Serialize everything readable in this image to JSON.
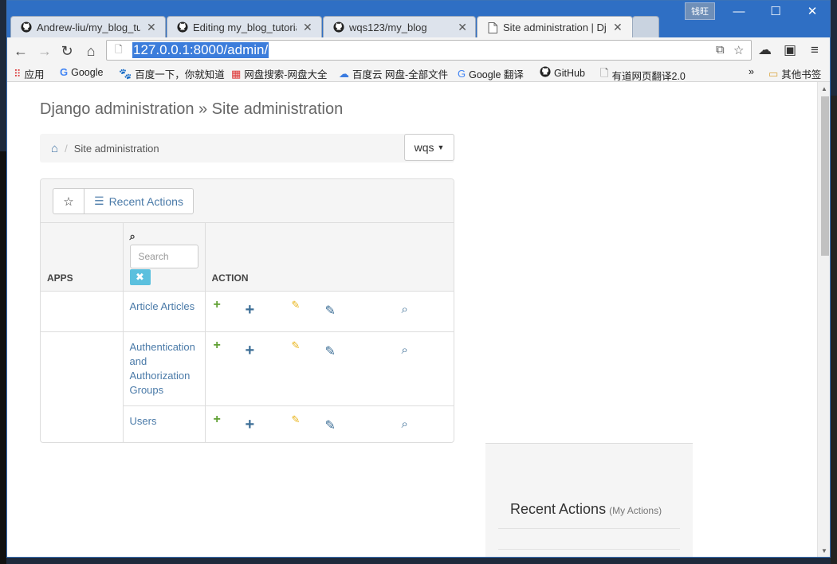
{
  "browser": {
    "tabs": [
      {
        "title": "Andrew-liu/my_blog_tutorial",
        "icon": "github-icon",
        "active": false
      },
      {
        "title": "Editing my_blog_tutorial",
        "icon": "github-icon",
        "active": false
      },
      {
        "title": "wqs123/my_blog",
        "icon": "github-icon",
        "active": false
      },
      {
        "title": "Site administration | Django",
        "icon": "page-icon",
        "active": true
      }
    ],
    "profile_badge": "钱旺",
    "url": "127.0.0.1:8000/admin/",
    "bookmarks": [
      {
        "label": "应用",
        "icon": "apps-grid-icon"
      },
      {
        "label": "Google",
        "icon": "google-icon"
      },
      {
        "label": "百度一下，你就知道",
        "icon": "baidu-icon"
      },
      {
        "label": "网盘搜索-网盘大全",
        "icon": "netdisk-icon"
      },
      {
        "label": "百度云 网盘-全部文件",
        "icon": "baiduyun-icon"
      },
      {
        "label": "Google 翻译",
        "icon": "translate-icon"
      },
      {
        "label": "GitHub",
        "icon": "github-icon"
      },
      {
        "label": "有道网页翻译2.0",
        "icon": "page-icon"
      }
    ],
    "other_bookmarks": "其他书签",
    "bookmark_overflow": "»"
  },
  "admin": {
    "site_title": "Django administration » Site administration",
    "breadcrumb_current": "Site administration",
    "user": "wqs",
    "recent_actions_button": "Recent Actions",
    "table": {
      "col_apps": "APPS",
      "col_action": "ACTION",
      "search_placeholder": "Search",
      "rows": [
        {
          "app": "",
          "model": "Article Articles"
        },
        {
          "app": "",
          "model": "Authentication and Authorization Groups"
        },
        {
          "app": "",
          "model": "Users"
        }
      ]
    },
    "recent_panel": {
      "title": "Recent Actions",
      "subtitle": "(My Actions)"
    }
  },
  "colors": {
    "titlebar": "#2f6fc4",
    "link": "#4a7aa8",
    "add_green": "#5fa032",
    "edit_yellow": "#e8b316",
    "clear_btn": "#5bc0de"
  }
}
